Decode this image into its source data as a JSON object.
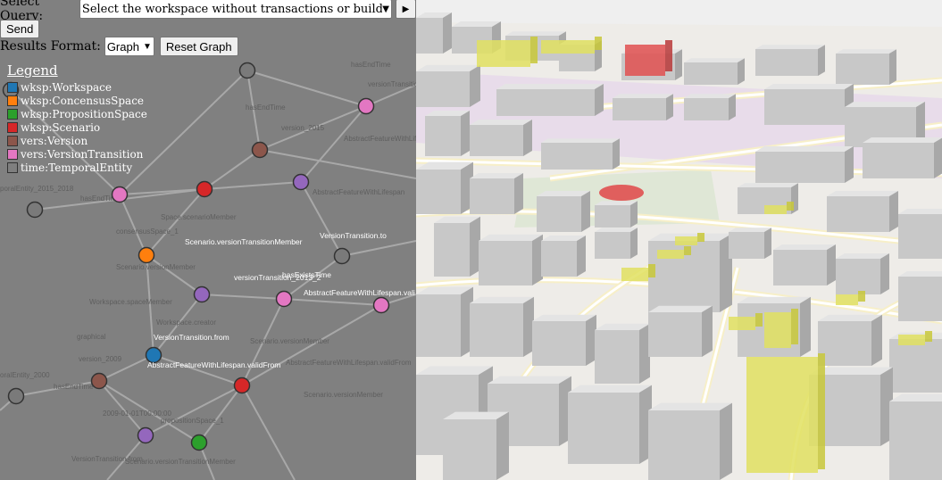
{
  "controls": {
    "query_label": "Select Query:",
    "query_selected": "Select the workspace without transactions or buildings",
    "play_icon": "play-icon",
    "send_label": "Send",
    "format_label": "Results Format:",
    "format_selected": "Graph",
    "reset_label": "Reset Graph"
  },
  "legend": {
    "title": "Legend",
    "items": [
      {
        "label": "wksp:Workspace",
        "color": "#1f77b4"
      },
      {
        "label": "wksp:ConcensusSpace",
        "color": "#ff7f0e"
      },
      {
        "label": "wksp:PropositionSpace",
        "color": "#2ca02c"
      },
      {
        "label": "wksp:Scenario",
        "color": "#d62728"
      },
      {
        "label": "vers:Version",
        "color": "#8c564b"
      },
      {
        "label": "vers:VersionTransition",
        "color": "#e377c2"
      },
      {
        "label": "time:TemporalEntity",
        "color": "#7f7f7f"
      }
    ]
  },
  "graph": {
    "bright_labels": [
      "Scenario.versionTransitionMember",
      "VersionTransition.to",
      "versionTransition_2013_2",
      "hasExistsTime",
      "AbstractFeatureWithLifespan.vali",
      "VersionTransition.from",
      "AbstractFeatureWithLifespan.validFrom"
    ],
    "faint_labels": [
      "hasEndTime",
      "versionTransition_2013_2015",
      "hasEndTime",
      "version_2015",
      "AbstractFeatureWithLifespan.validTo",
      "poralEntity_2015_2018",
      "hasEndTime",
      "Space.scenarioMember",
      "AbstractFeatureWithLifespan",
      "consensusSpace_1",
      "Scenario.versionMember",
      "Workspace.spaceMember",
      "Workspace.creator",
      "graphical",
      "version_2009",
      "oralEntity_2000",
      "hasEndTime",
      "AbstractFeatureWithLifespan.validFrom",
      "2009-01-01T00:00:00",
      "propositionSpace_1",
      "Scenario.versionMember",
      "VersionTransition.from",
      "Scenario.versionTransitionMember",
      "Scenario.versionMember"
    ]
  },
  "map": {
    "highlight_color": "#e0e060",
    "selected_color": "#e05050",
    "building_color": "#c8c8c8"
  }
}
